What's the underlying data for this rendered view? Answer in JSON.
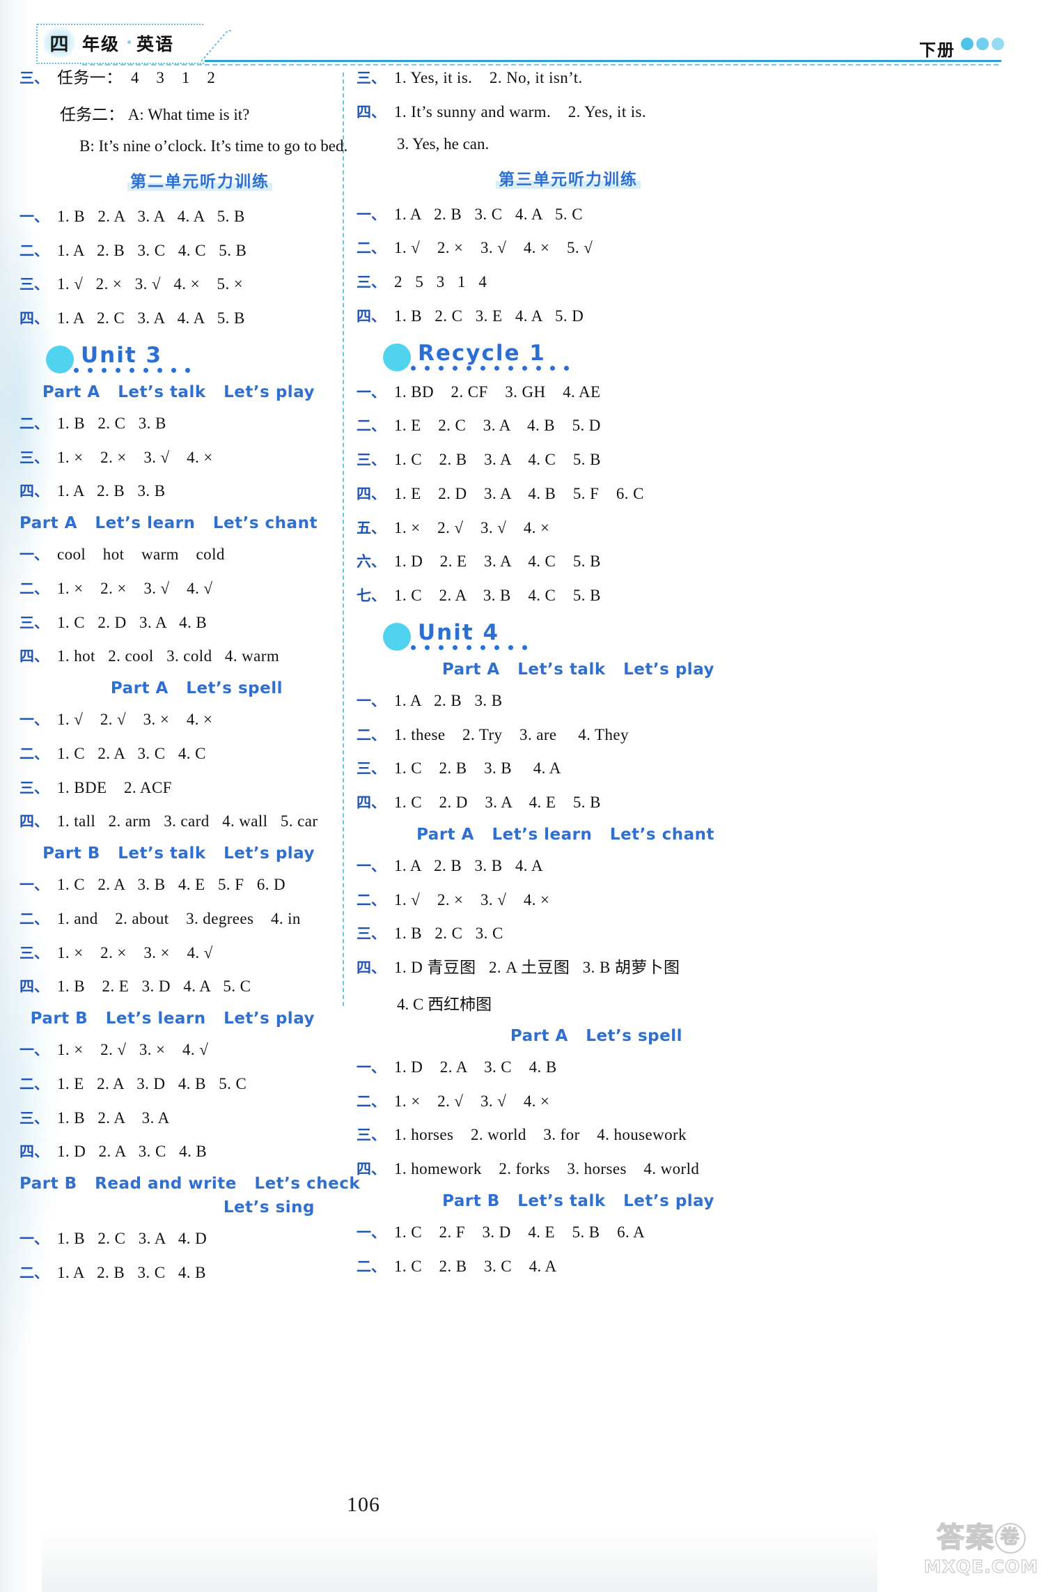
{
  "header": {
    "grade_badge": "四",
    "grade_text": "年级",
    "subject": "英语",
    "volume": "下册",
    "logo_icon": "three-dots-logo"
  },
  "page_number": "106",
  "watermark": {
    "cn": "答案",
    "cn_circle": "卷",
    "url": "MXQE.COM"
  },
  "left_column": {
    "blocks": [
      {
        "type": "rows",
        "rows": [
          {
            "cn": "三、",
            "text": "任务一：  4    3    1    2"
          }
        ]
      },
      {
        "type": "subline",
        "indent": "normal",
        "text": "任务二： A: What time is it?"
      },
      {
        "type": "subline",
        "indent": "deep2",
        "text": "B: It’s nine o’clock. It’s time to go to bed."
      },
      {
        "type": "unit_cap",
        "text": "第二单元听力训练"
      },
      {
        "type": "rows",
        "rows": [
          {
            "cn": "一、",
            "text": "1. B   2. A   3. A   4. A   5. B"
          },
          {
            "cn": "二、",
            "text": "1. A   2. B   3. C   4. C   5. B"
          },
          {
            "cn": "三、",
            "text": "1. √   2. ×   3. √   4. ×    5. ×"
          },
          {
            "cn": "四、",
            "text": "1. A   2. C   3. A   4. A   5. B"
          }
        ]
      },
      {
        "type": "unit_banner",
        "label": "Unit  3",
        "circle_icon": "unit-circle-icon",
        "dot_count": 9
      },
      {
        "type": "part_head",
        "text": "Part A   Let’s talk   Let’s play",
        "align": "right"
      },
      {
        "type": "rows",
        "rows": [
          {
            "cn": "二、",
            "text": "1. B   2. C   3. B"
          },
          {
            "cn": "三、",
            "text": "1. ×    2. ×    3. √    4. ×"
          },
          {
            "cn": "四、",
            "text": "1. A   2. B   3. B"
          }
        ]
      },
      {
        "type": "part_head",
        "text": "Part A   Let’s learn   Let’s chant",
        "align": "right"
      },
      {
        "type": "rows",
        "rows": [
          {
            "cn": "一、",
            "text": "cool    hot    warm    cold"
          },
          {
            "cn": "二、",
            "text": "1. ×    2. ×    3. √    4. √"
          },
          {
            "cn": "三、",
            "text": "1. C   2. D   3. A   4. B"
          },
          {
            "cn": "四、",
            "text": "1. hot   2. cool   3. cold   4. warm"
          }
        ]
      },
      {
        "type": "part_head",
        "text": "Part A   Let’s spell",
        "align": "mid"
      },
      {
        "type": "rows",
        "rows": [
          {
            "cn": "一、",
            "text": "1. √    2. √    3. ×    4. ×"
          },
          {
            "cn": "二、",
            "text": "1. C   2. A   3. C   4. C"
          },
          {
            "cn": "三、",
            "text": "1. BDE    2. ACF"
          },
          {
            "cn": "四、",
            "text": "1. tall   2. arm   3. card   4. wall   5. car"
          }
        ]
      },
      {
        "type": "part_head",
        "text": "Part B   Let’s talk   Let’s play",
        "align": "right"
      },
      {
        "type": "rows",
        "rows": [
          {
            "cn": "一、",
            "text": "1. C   2. A   3. B   4. E   5. F   6. D"
          },
          {
            "cn": "二、",
            "text": "1. and    2. about    3. degrees    4. in"
          },
          {
            "cn": "三、",
            "text": "1. ×    2. ×    3. ×    4. √"
          },
          {
            "cn": "四、",
            "text": "1. B    2. E   3. D   4. A   5. C"
          }
        ]
      },
      {
        "type": "part_head",
        "text": "Part B   Let’s learn   Let’s play",
        "align": "right"
      },
      {
        "type": "rows",
        "rows": [
          {
            "cn": "一、",
            "text": "1. ×    2. √   3. ×    4. √"
          },
          {
            "cn": "二、",
            "text": "1. E   2. A   3. D   4. B   5. C"
          },
          {
            "cn": "三、",
            "text": "1. B   2. A    3. A"
          },
          {
            "cn": "四、",
            "text": "1. D   2. A   3. C   4. B"
          }
        ]
      },
      {
        "type": "part_head",
        "text": "Part B   Read and write   Let’s check",
        "align": "right"
      },
      {
        "type": "part_head_second",
        "text": "Let’s sing",
        "align": "right"
      },
      {
        "type": "rows",
        "rows": [
          {
            "cn": "一、",
            "text": "1. B   2. C   3. A   4. D"
          },
          {
            "cn": "二、",
            "text": "1. A   2. B   3. C   4. B"
          }
        ]
      }
    ]
  },
  "right_column": {
    "blocks": [
      {
        "type": "rows",
        "rows": [
          {
            "cn": "三、",
            "text": "1. Yes, it is.    2. No, it isn’t."
          },
          {
            "cn": "四、",
            "text": "1. It’s sunny and warm.    2. Yes, it is."
          }
        ]
      },
      {
        "type": "subline",
        "indent": "normal",
        "text": "3. Yes, he can."
      },
      {
        "type": "unit_cap",
        "text": "第三单元听力训练"
      },
      {
        "type": "rows",
        "rows": [
          {
            "cn": "一、",
            "text": "1. A   2. B   3. C   4. A   5. C"
          },
          {
            "cn": "二、",
            "text": "1. √    2. ×    3. √    4. ×    5. √"
          },
          {
            "cn": "三、",
            "text": "2   5   3   1   4"
          },
          {
            "cn": "四、",
            "text": "1. B   2. C   3. E   4. A   5. D"
          }
        ]
      },
      {
        "type": "unit_banner",
        "label": "Recycle  1",
        "circle_icon": "unit-circle-icon",
        "dot_count": 12
      },
      {
        "type": "rows",
        "rows": [
          {
            "cn": "一、",
            "text": "1. BD    2. CF    3. GH    4. AE"
          },
          {
            "cn": "二、",
            "text": "1. E    2. C    3. A    4. B    5. D"
          },
          {
            "cn": "三、",
            "text": "1. C    2. B    3. A    4. C    5. B"
          },
          {
            "cn": "四、",
            "text": "1. E    2. D    3. A    4. B    5. F    6. C"
          },
          {
            "cn": "五、",
            "text": "1. ×    2. √    3. √    4. ×"
          },
          {
            "cn": "六、",
            "text": "1. D    2. E    3. A    4. C    5. B"
          },
          {
            "cn": "七、",
            "text": "1. C    2. A    3. B    4. C    5. B"
          }
        ]
      },
      {
        "type": "unit_banner",
        "label": "Unit  4",
        "circle_icon": "unit-circle-icon",
        "dot_count": 9
      },
      {
        "type": "part_head",
        "text": "Part A   Let’s talk   Let’s play",
        "align": "right"
      },
      {
        "type": "rows",
        "rows": [
          {
            "cn": "一、",
            "text": "1. A   2. B   3. B"
          },
          {
            "cn": "二、",
            "text": "1. these    2. Try    3. are     4. They"
          },
          {
            "cn": "三、",
            "text": "1. C    2. B    3. B     4. A"
          },
          {
            "cn": "四、",
            "text": "1. C    2. D    3. A    4. E    5. B"
          }
        ]
      },
      {
        "type": "part_head",
        "text": "Part A   Let’s learn   Let’s chant",
        "align": "right"
      },
      {
        "type": "rows",
        "rows": [
          {
            "cn": "一、",
            "text": "1. A   2. B   3. B   4. A"
          },
          {
            "cn": "二、",
            "text": "1. √    2. ×    3. √    4. ×"
          },
          {
            "cn": "三、",
            "text": "1. B   2. C   3. C"
          },
          {
            "cn": "四、",
            "text": "1. D 青豆图   2. A 土豆图   3. B 胡萝卜图"
          }
        ]
      },
      {
        "type": "subline",
        "indent": "normal",
        "text": "4. C 西红柿图"
      },
      {
        "type": "part_head",
        "text": "Part A   Let’s spell",
        "align": "mid"
      },
      {
        "type": "rows",
        "rows": [
          {
            "cn": "一、",
            "text": "1. D    2. A    3. C    4. B"
          },
          {
            "cn": "二、",
            "text": "1. ×    2. √    3. √    4. ×"
          },
          {
            "cn": "三、",
            "text": "1. horses    2. world    3. for    4. housework"
          },
          {
            "cn": "四、",
            "text": "1. homework    2. forks    3. horses    4. world"
          }
        ]
      },
      {
        "type": "part_head",
        "text": "Part B   Let’s talk   Let’s play",
        "align": "right"
      },
      {
        "type": "rows",
        "rows": [
          {
            "cn": "一、",
            "text": "1. C    2. F    3. D    4. E    5. B    6. A"
          },
          {
            "cn": "二、",
            "text": "1. C    2. B    3. C    4. A"
          }
        ]
      }
    ]
  }
}
